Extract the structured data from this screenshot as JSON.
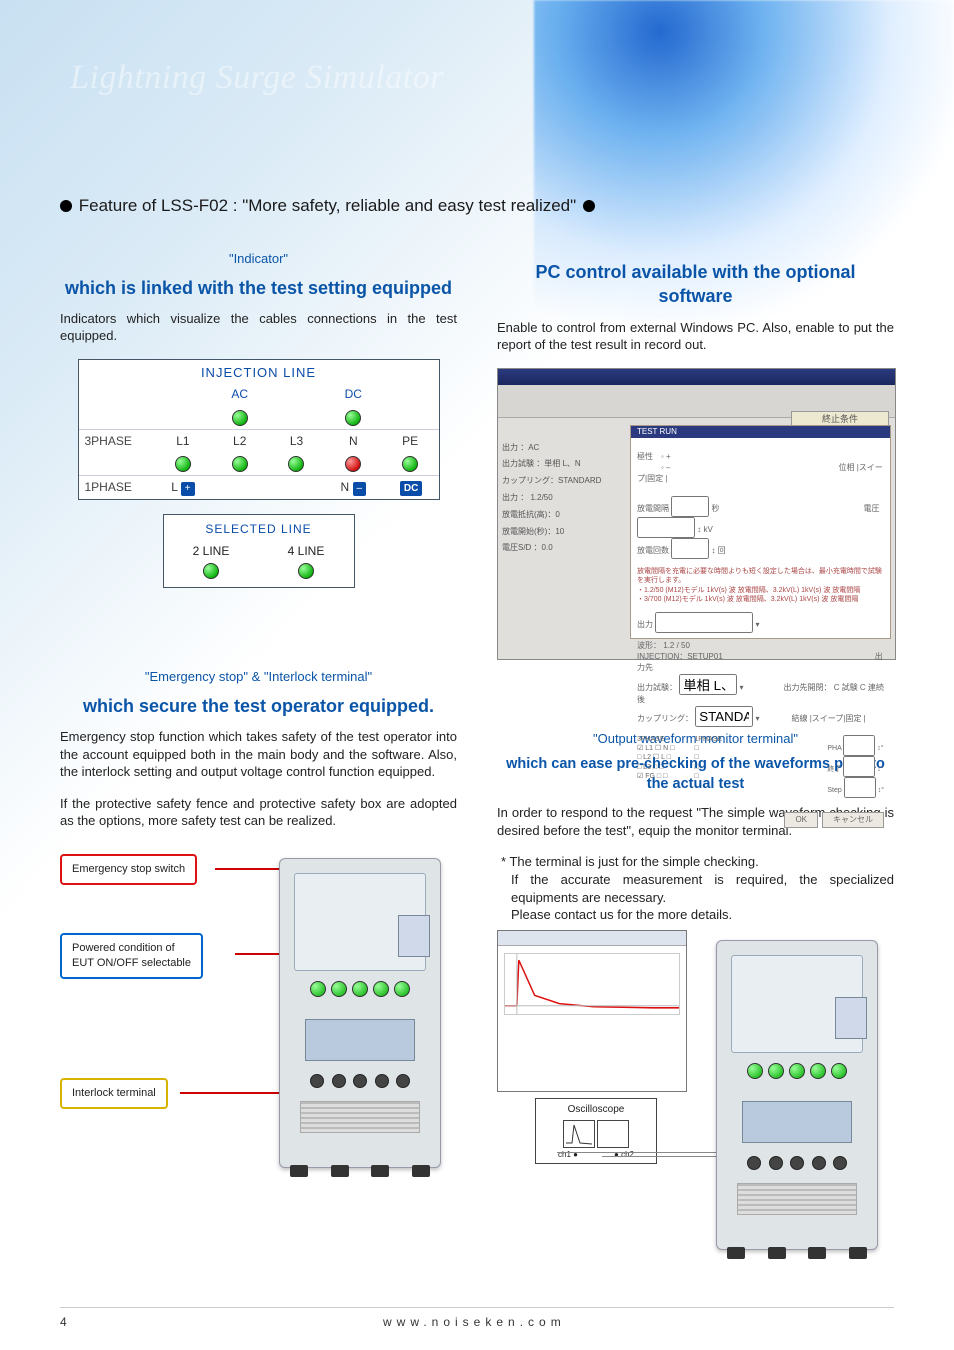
{
  "watermark": "Lightning Surge Simulator",
  "feature_headline": "Feature of LSS-F02 : \"More safety, reliable and easy test realized\"",
  "sections": {
    "indicator": {
      "pretitle": "\"Indicator\"",
      "title": "which is linked with the test setting equipped",
      "body": "Indicators which visualize the cables connections in the test equipped.",
      "diagram": {
        "title": "INJECTION LINE",
        "ac_label": "AC",
        "dc_label": "DC",
        "row_3phase": "3PHASE",
        "row_1phase": "1PHASE",
        "cols": [
          "L1",
          "L2",
          "L3",
          "N",
          "PE"
        ],
        "one_L": "L",
        "one_plus": "+",
        "one_N": "N",
        "one_minus": "–",
        "one_dc": "DC",
        "selected_title": "SELECTED LINE",
        "selected_2": "2 LINE",
        "selected_4": "4 LINE"
      }
    },
    "pc": {
      "title": "PC control available with the optional software",
      "body": "Enable to control from external Windows PC.   Also, enable to put the report of the test result in record out.",
      "tab_label": "終止条件"
    },
    "emergency": {
      "pretitle": "\"Emergency stop\" & \"Interlock terminal\"",
      "title": "which secure the test operator equipped.",
      "body1": "Emergency stop function which takes safety of the test operator into the account equipped both in the main body and the software.  Also, the interlock setting and output voltage control function equipped.",
      "body2": "If the protective safety fence and protective safety box are adopted as the options, more safety test can be realized.",
      "callout_estop": "Emergency stop switch",
      "callout_power": "Powered condition of\nEUT ON/OFF selectable",
      "callout_interlock": "Interlock terminal"
    },
    "waveform": {
      "pretitle": "\"Output waveform monitor terminal\"",
      "title": "which can ease pre-checking of the waveforms prior to the actual test",
      "body": "In order to respond to the request \"The simple waveform checking is desired before the test\", equip the monitor terminal.",
      "note1": "The terminal is just for the simple checking.",
      "note2": "If the accurate measurement is required, the specialized equipments are necessary.",
      "note3": "Please contact us for the more details.",
      "osc_label": "Oscilloscope",
      "ch1": "ch1",
      "ch2": "ch2"
    }
  },
  "footer": {
    "page": "4",
    "url": "www.noiseken.com"
  }
}
